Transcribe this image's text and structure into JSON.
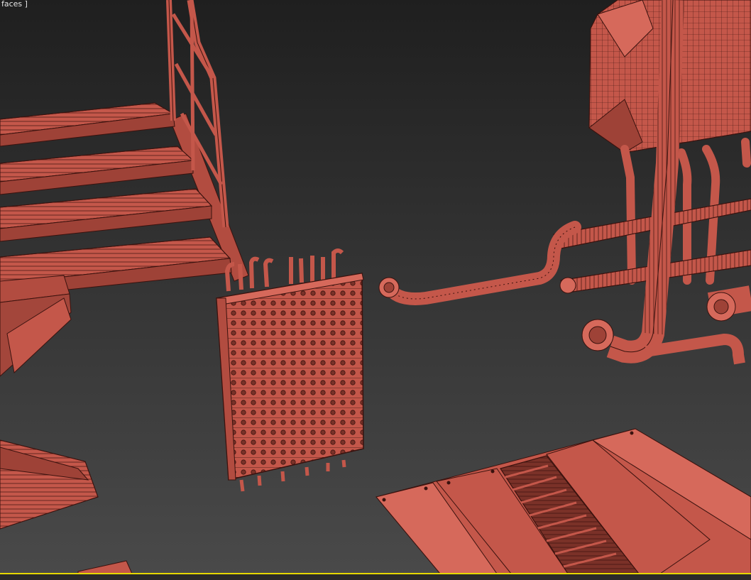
{
  "viewport": {
    "label": "faces ]",
    "active": true
  },
  "colors": {
    "mesh_fill": "#c4574a",
    "mesh_fill_light": "#d6695b",
    "mesh_fill_dark": "#9e4237",
    "wire": "#3a120e",
    "active_border": "#e6d800",
    "bg_top": "#1f1f1f",
    "bg_bottom": "#4a4a4a"
  },
  "objects": [
    {
      "name": "staircase-with-handrail"
    },
    {
      "name": "vertical-grate-panel"
    },
    {
      "name": "pipe-machinery-cluster"
    },
    {
      "name": "floor-vent-panel"
    },
    {
      "name": "support-beam"
    }
  ]
}
